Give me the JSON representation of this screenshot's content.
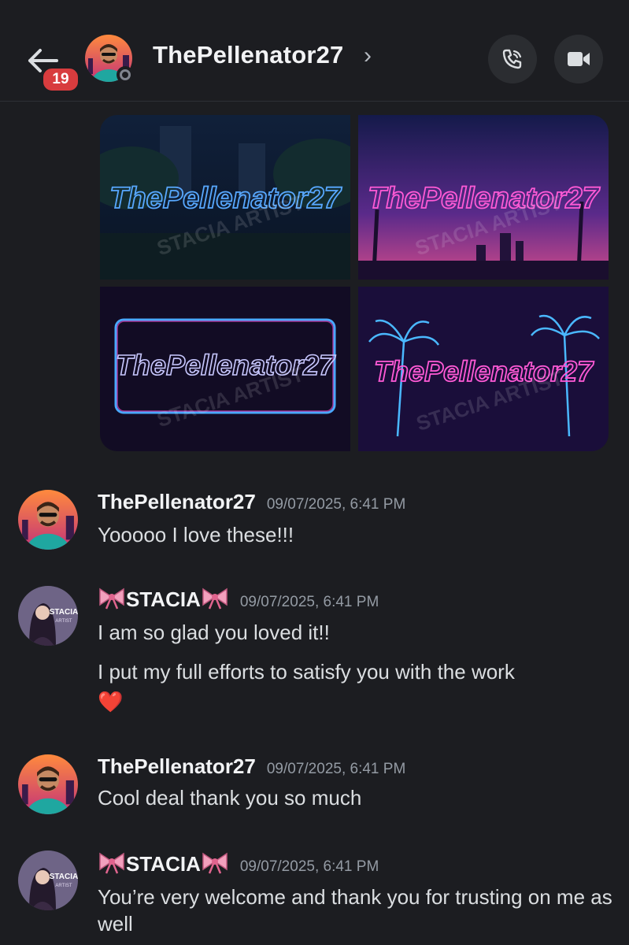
{
  "header": {
    "unread_count": "19",
    "username": "ThePellenator27",
    "chevron": "›",
    "icons": {
      "back": "arrow-left-icon",
      "call": "phone-call-icon",
      "video": "video-camera-icon"
    }
  },
  "attachments": {
    "watermark": "STACIA ARTIST",
    "images": [
      {
        "text": "ThePellenator27",
        "style": "blue neon, dark city park"
      },
      {
        "text": "ThePellenator27",
        "style": "pink neon, palm sunset skyline"
      },
      {
        "text": "ThePellenator27",
        "style": "neon frame"
      },
      {
        "text": "ThePellenator27",
        "style": "neon palm trees"
      }
    ]
  },
  "messages": [
    {
      "author": "ThePellenator27",
      "timestamp": "09/07/2025, 6:41 PM",
      "lines": [
        "Yooooo I love these!!!"
      ]
    },
    {
      "author": "STACIA",
      "author_decoration": "bow-emoji",
      "timestamp": "09/07/2025, 6:41 PM",
      "lines": [
        "I am so glad you loved it!!",
        "I put my full efforts to satisfy you with the work",
        "❤️"
      ]
    },
    {
      "author": "ThePellenator27",
      "timestamp": "09/07/2025, 6:41 PM",
      "lines": [
        "Cool deal thank you so much"
      ]
    },
    {
      "author": "STACIA",
      "author_decoration": "bow-emoji",
      "timestamp": "09/07/2025, 6:41 PM",
      "lines": [
        "You’re very welcome and thank you for trusting on me as well"
      ]
    }
  ],
  "avatars": {
    "stacia_label_1": "STACIA",
    "stacia_label_2": "ARTIST"
  },
  "colors": {
    "background": "#1c1d21",
    "badge": "#d83c3e",
    "timestamp": "#949ba4"
  }
}
